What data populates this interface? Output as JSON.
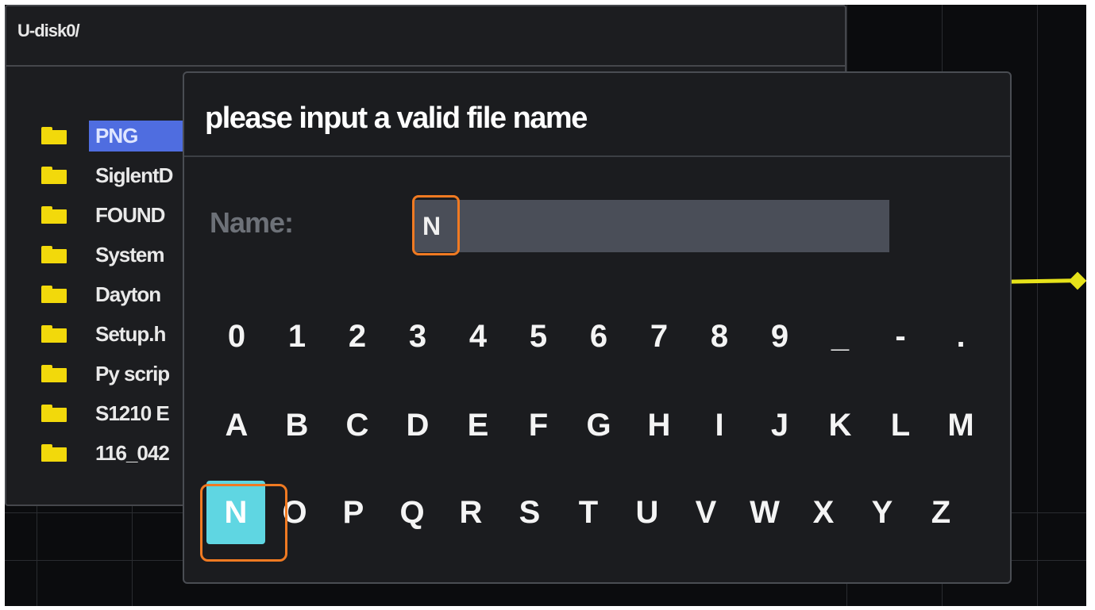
{
  "browser": {
    "path": "U-disk0/",
    "items": [
      {
        "label": "PNG",
        "selected": true
      },
      {
        "label": "SiglentD"
      },
      {
        "label": "FOUND"
      },
      {
        "label": "System"
      },
      {
        "label": "Dayton"
      },
      {
        "label": "Setup.h"
      },
      {
        "label": "Py scrip"
      },
      {
        "label": "S1210 E"
      },
      {
        "label": "116_042"
      }
    ]
  },
  "dialog": {
    "title": "please input a valid file name",
    "name_label": "Name:",
    "name_value": "N"
  },
  "keyboard": {
    "row_digits": [
      "0",
      "1",
      "2",
      "3",
      "4",
      "5",
      "6",
      "7",
      "8",
      "9",
      "_",
      "-",
      "."
    ],
    "row_upper1": [
      "A",
      "B",
      "C",
      "D",
      "E",
      "F",
      "G",
      "H",
      "I",
      "J",
      "K",
      "L",
      "M"
    ],
    "row_upper2": [
      "N",
      "O",
      "P",
      "Q",
      "R",
      "S",
      "T",
      "U",
      "V",
      "W",
      "X",
      "Y",
      "Z"
    ],
    "active_key": "N"
  },
  "colors": {
    "selection": "#4f6de0",
    "active_key": "#5fd6e2",
    "highlight_ring": "#f07a22",
    "folder": "#f2d90b",
    "trace": "#e6e21a"
  }
}
